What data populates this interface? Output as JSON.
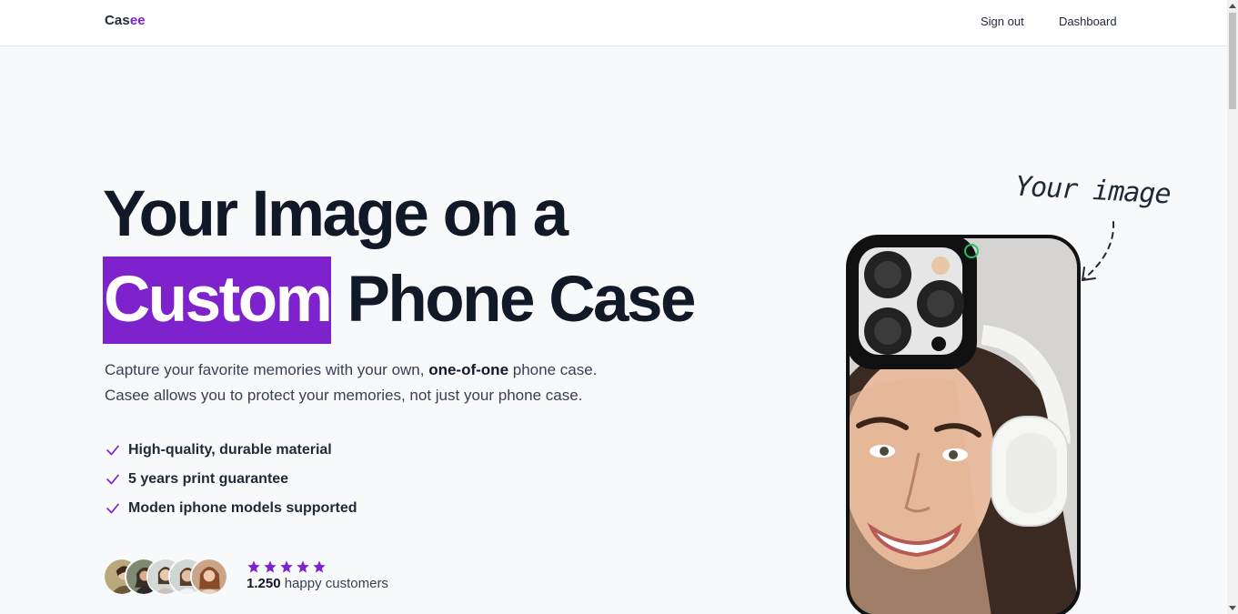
{
  "nav": {
    "logo_main": "Cas",
    "logo_accent": "ee",
    "signout": "Sign out",
    "dashboard": "Dashboard"
  },
  "hero": {
    "headline_line1": "Your Image on a",
    "headline_highlight": "Custom",
    "headline_rest": "Phone Case",
    "desc_part1": "Capture your favorite memories with your own, ",
    "desc_bold": "one-of-one",
    "desc_part2": " phone case.",
    "desc_line2": "Casee allows you to protect your memories, not just your phone case.",
    "features": [
      "High-quality, durable material",
      "5 years print guarantee",
      "Moden iphone models supported"
    ],
    "rating_count": "1.250",
    "rating_label": " happy customers",
    "stars": 5,
    "annotation": "Your image"
  },
  "colors": {
    "accent": "#7e22ce",
    "text_dark": "#111827",
    "background": "#f8f9fb"
  }
}
